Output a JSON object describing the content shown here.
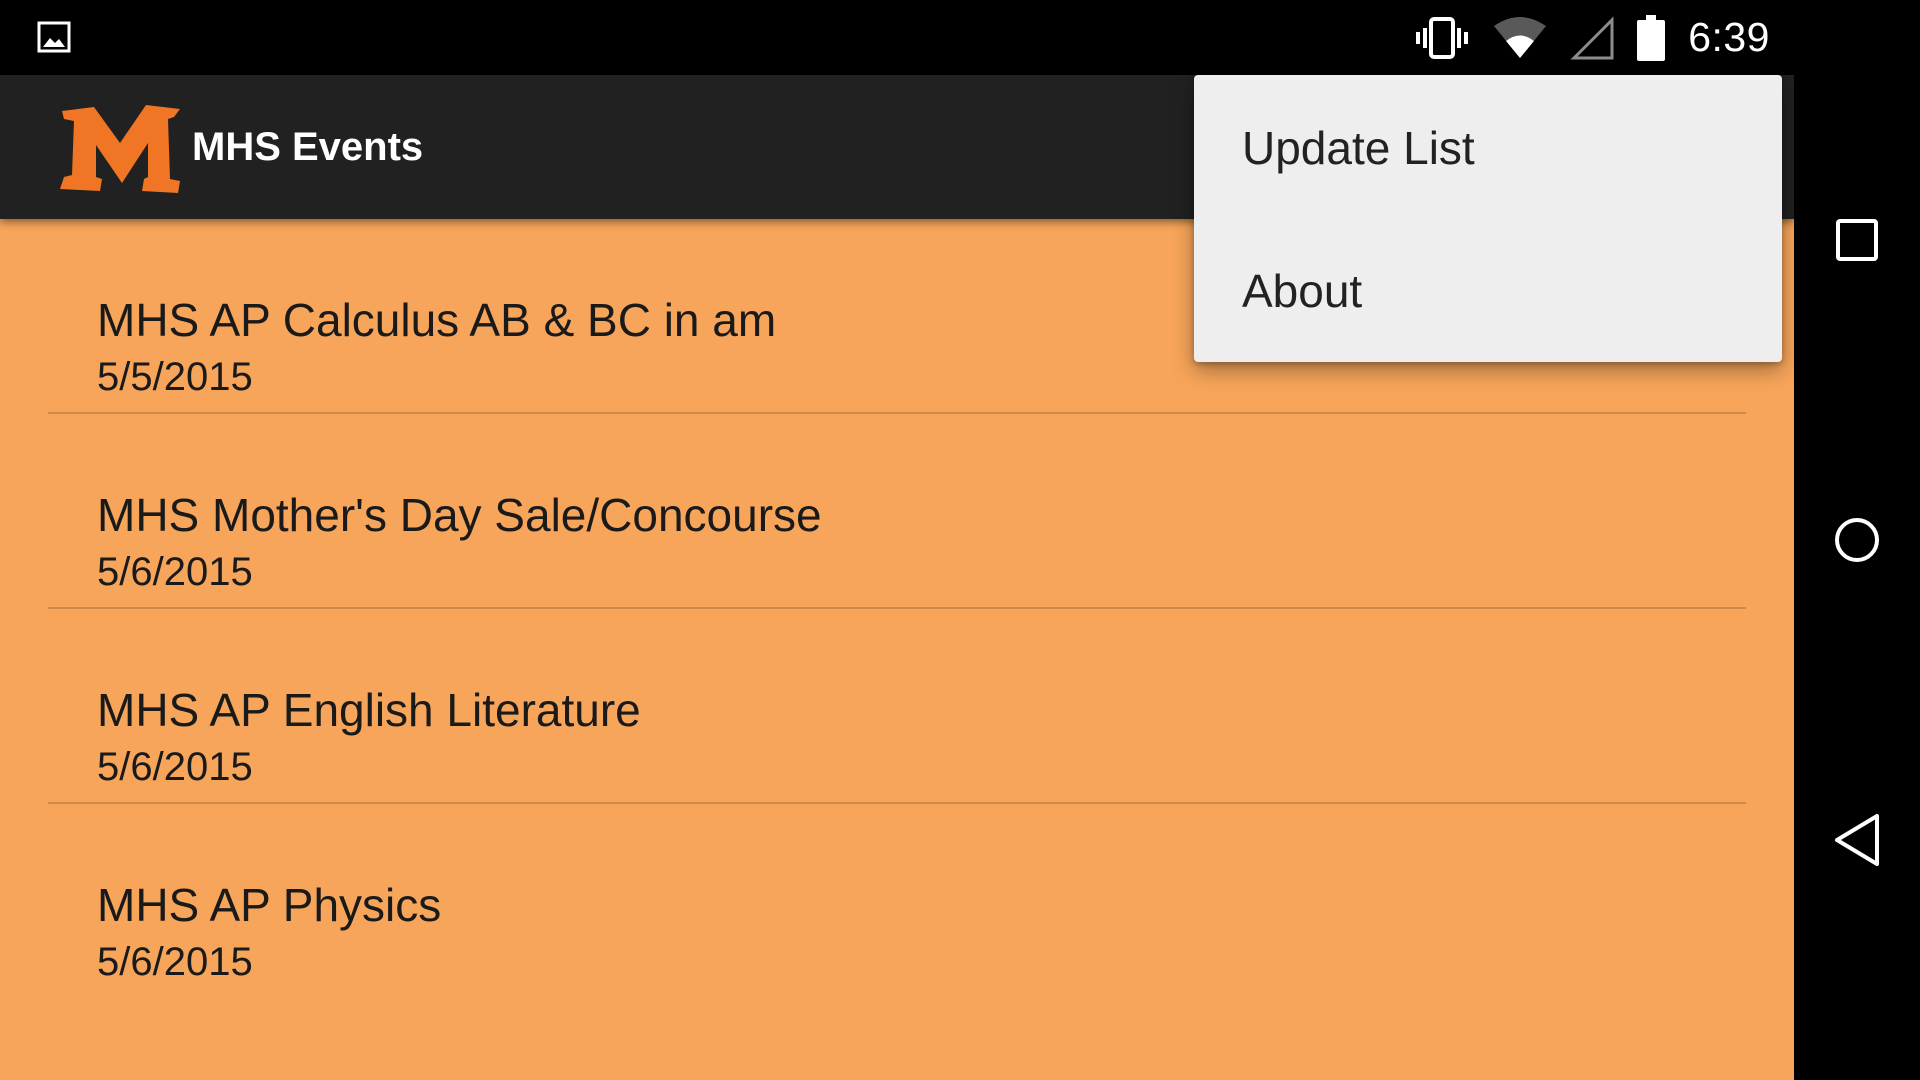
{
  "status_bar": {
    "time": "6:39",
    "icons": [
      "image-notification-icon",
      "vibrate-icon",
      "wifi-icon",
      "cell-signal-icon",
      "battery-icon"
    ]
  },
  "app": {
    "title": "MHS Events",
    "logo_letter": "M",
    "colors": {
      "background": "#f7a55a",
      "action_bar": "#212121",
      "logo": "#f07524",
      "menu": "#eeeeee"
    }
  },
  "events": [
    {
      "title": "MHS AP Calculus AB & BC in am",
      "date": "5/5/2015"
    },
    {
      "title": "MHS Mother's Day Sale/Concourse",
      "date": "5/6/2015"
    },
    {
      "title": "MHS AP English Literature",
      "date": "5/6/2015"
    },
    {
      "title": "MHS AP Physics",
      "date": "5/6/2015"
    }
  ],
  "overflow_menu": {
    "items": [
      {
        "label": "Update List"
      },
      {
        "label": "About"
      }
    ]
  },
  "nav_bar": {
    "buttons": [
      "recents-icon",
      "home-icon",
      "back-icon"
    ]
  }
}
